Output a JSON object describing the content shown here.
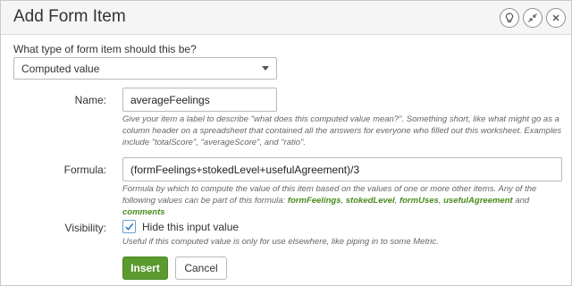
{
  "dialog": {
    "title": "Add Form Item",
    "header_icons": [
      "lightbulb-icon",
      "collapse-arrows-icon",
      "close-icon"
    ]
  },
  "item_type": {
    "question": "What type of form item should this be?",
    "selected": "Computed value"
  },
  "name_field": {
    "label": "Name:",
    "value": "averageFeelings",
    "help": "Give your item a label to describe \"what does this computed value mean?\". Something short, like what might go as a column header on a spreadsheet that contained all the answers for everyone who filled out this worksheet. Examples include \"totalScore\", \"averageScore\", and \"ratio\"."
  },
  "formula_field": {
    "label": "Formula:",
    "value": "(formFeelings+stokedLevel+usefulAgreement)/3",
    "help_prefix": "Formula by which to compute the value of this item based on the values of one or more other items. Any of the following values can be part of this formula: ",
    "variables": [
      "formFeelings",
      "stokedLevel",
      "formUses",
      "usefulAgreement",
      "comments"
    ],
    "sep_comma": ", ",
    "sep_and": " and "
  },
  "visibility": {
    "label": "Visibility:",
    "checkbox_label": "Hide this input value",
    "checked": true,
    "help": "Useful if this computed value is only for use elsewhere, like piping in to some Metric."
  },
  "buttons": {
    "insert": "Insert",
    "cancel": "Cancel"
  },
  "colors": {
    "primary_button": "#5a9a2e",
    "variable_link": "#4a8a1c",
    "checkbox_check": "#3a7fc0"
  }
}
